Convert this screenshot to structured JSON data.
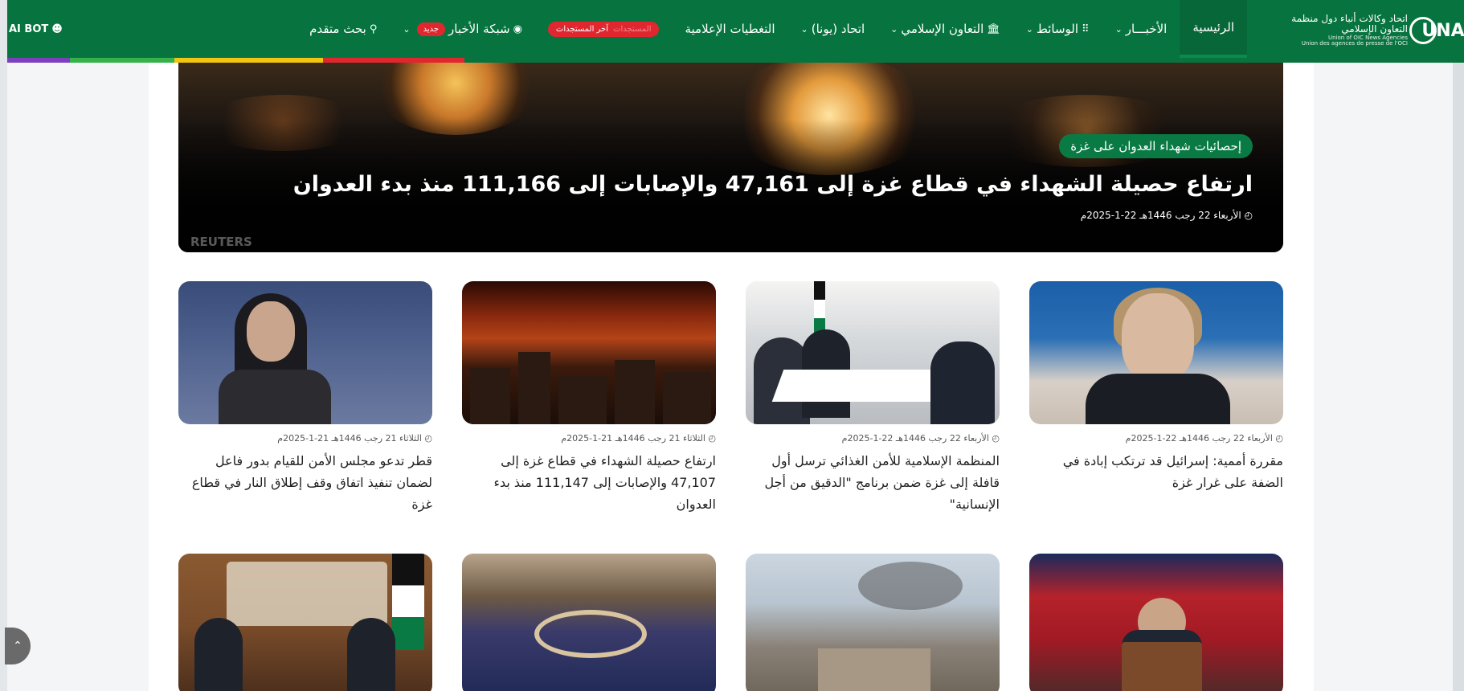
{
  "nav": {
    "logo_ar": "اتحاد وكالات أنباء دول منظمة التعاون الإسلامي",
    "logo_en1": "Union of OIC News Agencies",
    "logo_en2": "Union des agences de presse de l'OCI",
    "logo_mark": "UNA",
    "items": [
      {
        "label": "الرئيسية",
        "active": true
      },
      {
        "label": "الأخبـــار",
        "has_chevron": true
      },
      {
        "label": "الوسائط",
        "has_chevron": true,
        "icon": "grid-icon"
      },
      {
        "label": "التعاون الإسلامي",
        "has_chevron": true,
        "icon": "building-icon"
      },
      {
        "label": "اتحاد (يونا)",
        "has_chevron": true
      },
      {
        "label": "التغطيات الإعلامية"
      }
    ],
    "live_dim_label": "المستجدات",
    "live_label": "آخر المستجدات",
    "network_label": "شبكة الأخبار",
    "new_badge": "جديد",
    "search_label": "بحث متقدم",
    "ai_bot_label": "AI BOT",
    "accent_colors": [
      "#7b3fbf",
      "#36b24a",
      "#f2c511",
      "#e0272f"
    ]
  },
  "hero": {
    "tag": "إحصائيات شهداء العدوان على غزة",
    "title": "ارتفاع حصيلة الشهداء في قطاع غزة إلى 47,161 والإصابات إلى 111,166 منذ بدء العدوان",
    "date": "الأربعاء 22 رجب 1446هـ 22-1-2025م",
    "credit": "REUTERS"
  },
  "cards": [
    {
      "date": "الأربعاء 22 رجب 1446هـ 22-1-2025م",
      "title": "مقررة أممية: إسرائيل قد ترتكب إبادة في الضفة على غرار غزة",
      "thumb": "t1"
    },
    {
      "date": "الأربعاء 22 رجب 1446هـ 22-1-2025م",
      "title": "المنظمة الإسلامية للأمن الغذائي ترسل أول قافلة إلى غزة ضمن برنامج \"الدقيق من أجل الإنسانية\"",
      "thumb": "t2"
    },
    {
      "date": "الثلاثاء 21 رجب 1446هـ 21-1-2025م",
      "title": "ارتفاع حصيلة الشهداء في قطاع غزة إلى 47,107 والإصابات إلى 111,147 منذ بدء العدوان",
      "thumb": "t3"
    },
    {
      "date": "الثلاثاء 21 رجب 1446هـ 21-1-2025م",
      "title": "قطر تدعو مجلس الأمن للقيام بدور فاعل لضمان تنفيذ اتفاق وقف إطلاق النار في قطاع غزة",
      "thumb": "t4"
    },
    {
      "date": "",
      "title": "",
      "thumb": "t5"
    },
    {
      "date": "",
      "title": "",
      "thumb": "t6"
    },
    {
      "date": "",
      "title": "",
      "thumb": "t7"
    },
    {
      "date": "",
      "title": "",
      "thumb": "t8"
    }
  ]
}
